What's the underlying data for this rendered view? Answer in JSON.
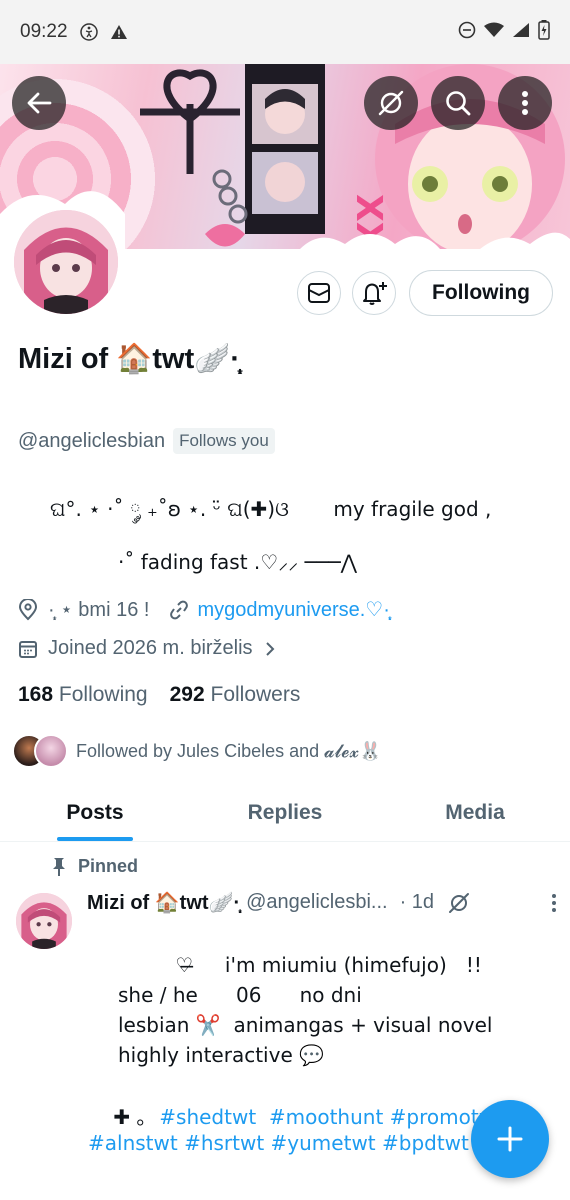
{
  "status_bar": {
    "time": "09:22"
  },
  "profile": {
    "name": "Mizi of 🏠twt🪽·̩͙",
    "handle": "@angeliclesbian",
    "follows_you": "Follows you",
    "follow_button": "Following",
    "bio": {
      "line1": "ଘ°. ⋆ ·˚ ༘ ₊˚ʚ ⋆. ᵕ̈ ଘ(✚)ଓ       my fragile god ,",
      "line2": "·˚ fading fast .♡⸝⸝ ───⋀"
    },
    "location": "·̩͙ ⋆ bmi 16 !",
    "website": "mygodmyuniverse.♡·̩͙",
    "joined": "Joined 2026 m. birželis",
    "following_count": "168",
    "following_label": "Following",
    "followers_count": "292",
    "followers_label": "Followers",
    "followed_by": "Followed by Jules Cibeles and 𝓪𝓵𝓮𝔁🐰"
  },
  "tabs": [
    {
      "label": "Posts",
      "active": true
    },
    {
      "label": "Replies",
      "active": false
    },
    {
      "label": "Media",
      "active": false
    }
  ],
  "pinned_post": {
    "pinned_label": "Pinned",
    "author_name": "Mizi of 🏠twt🪽·̩͙",
    "author_handle": "@angeliclesbi...",
    "time": "· 1d",
    "lines": {
      "l1": "         ♡̶     i'm miumiu (himefujo)   !!",
      "l2": "she / he      06      no dni",
      "l3": "lesbian ✂️  animangas + visual novel",
      "l4": "highly interactive 💬",
      "l5_prefix": "    ✚ ｡  ",
      "l5_tags": "#shedtwt  #moothunt #promotwt",
      "l6_tags": "#alnstwt #hsrtwt #yumetwt #bpdtwt"
    }
  },
  "colors": {
    "accent": "#1d9bf0",
    "muted": "#536471",
    "text": "#0f1419"
  }
}
